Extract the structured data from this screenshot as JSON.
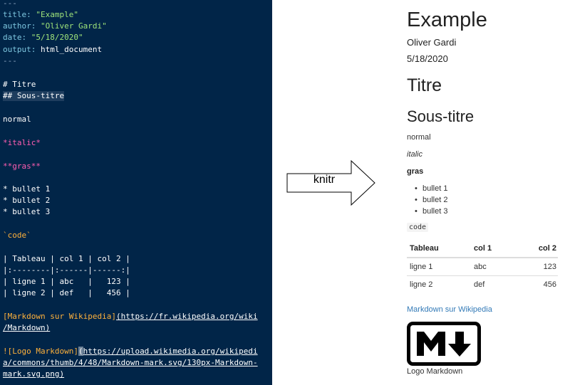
{
  "editor": {
    "yaml_open": "---",
    "title_key": "title:",
    "title_val": "\"Example\"",
    "author_key": "author:",
    "author_val": "\"Oliver Gardi\"",
    "date_key": "date:",
    "date_val": "\"5/18/2020\"",
    "output_key": "output:",
    "output_val": "html_document",
    "yaml_close": "---",
    "h1_line": "# Titre",
    "h2_line": "## Sous-titre",
    "normal_line": "normal",
    "italic_line": "*italic*",
    "bold_line": "**gras**",
    "bullets": [
      "* bullet 1",
      "* bullet 2",
      "* bullet 3"
    ],
    "code_line": "`code`",
    "table_lines": [
      "| Tableau | col 1 | col 2 |",
      "|:--------|:------|------:|",
      "| ligne 1 | abc   |   123 |",
      "| ligne 2 | def   |   456 |"
    ],
    "link_text": "[Markdown sur Wikipedia]",
    "link_url_1": "(https://fr.wikipedia.org/wiki",
    "link_url_2": "/Markdown)",
    "img_text": "![Logo Markdown]",
    "img_url_open": "(",
    "img_url_1": "https://upload.wikimedia.org/wikipedi",
    "img_url_2": "a/commons/thumb/4/48/Markdown-mark.svg/130px-Markdown-",
    "img_url_3": "mark.svg.png)"
  },
  "arrow": {
    "label": "knitr"
  },
  "rendered": {
    "title": "Example",
    "author": "Oliver Gardi",
    "date": "5/18/2020",
    "h1": "Titre",
    "h2": "Sous-titre",
    "normal": "normal",
    "italic": "italic",
    "bold": "gras",
    "bullets": [
      "bullet 1",
      "bullet 2",
      "bullet 3"
    ],
    "code": "code",
    "table": {
      "headers": [
        "Tableau",
        "col 1",
        "col 2"
      ],
      "rows": [
        [
          "ligne 1",
          "abc",
          "123"
        ],
        [
          "ligne 2",
          "def",
          "456"
        ]
      ]
    },
    "link": "Markdown sur Wikipedia",
    "image_caption": "Logo Markdown",
    "link_color": "#337ab7"
  },
  "colors": {
    "editor_bg": "#012548",
    "yaml_key": "#7ec7e0",
    "yaml_string": "#9fe47a",
    "emphasis": "#ff5db1",
    "code_link": "#ffb13b"
  },
  "icons": {
    "logo": "markdown-mark-icon"
  }
}
